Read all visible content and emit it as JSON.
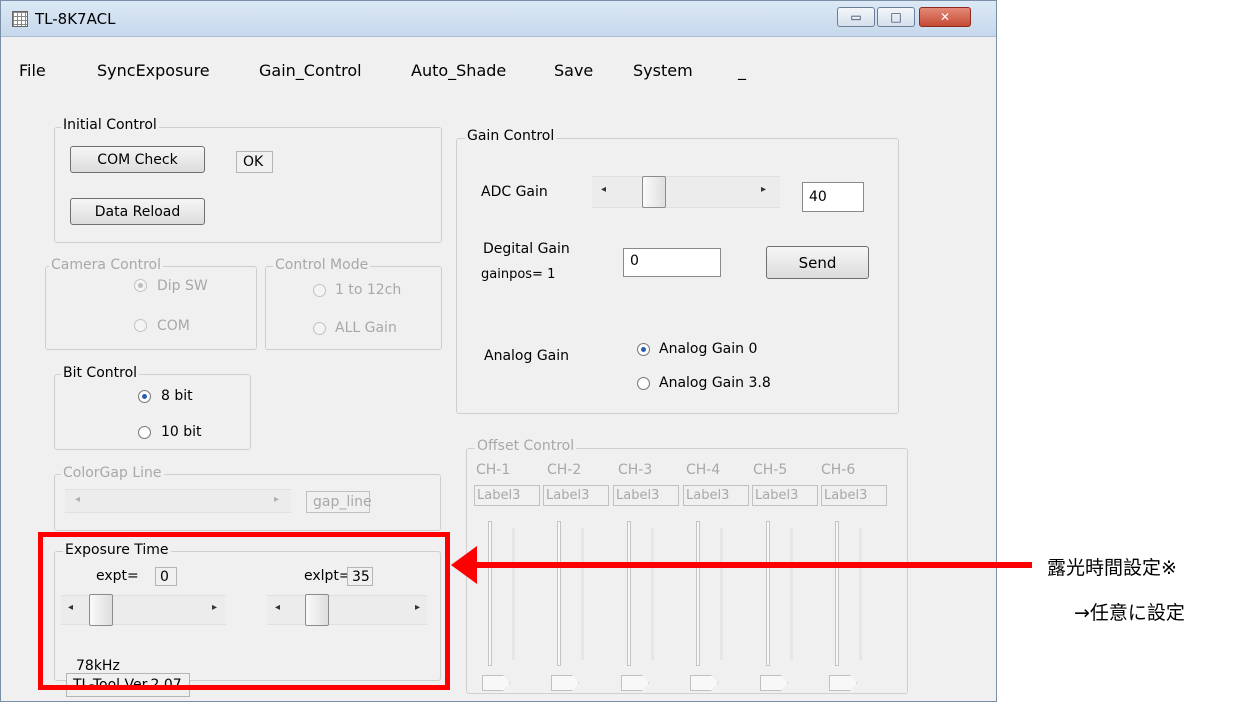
{
  "window": {
    "title": "TL-8K7ACL",
    "controls": {
      "minimize": "▭",
      "maximize": "□",
      "close": "✕"
    }
  },
  "menu": {
    "items": [
      "File",
      "SyncExposure",
      "Gain_Control",
      "Auto_Shade",
      "Save",
      "System",
      "_"
    ]
  },
  "initial_control": {
    "title": "Initial Control",
    "com_check_label": "COM Check",
    "com_status": "OK",
    "data_reload_label": "Data Reload"
  },
  "camera_control": {
    "title": "Camera Control",
    "options": [
      "Dip SW",
      "COM"
    ],
    "selected": "Dip SW"
  },
  "control_mode": {
    "title": "Control Mode",
    "options": [
      "1 to 12ch",
      "ALL Gain"
    ]
  },
  "bit_control": {
    "title": "Bit Control",
    "options": [
      "8 bit",
      "10 bit"
    ],
    "selected": "8 bit"
  },
  "color_gap": {
    "title": "ColorGap Line",
    "value": "gap_line"
  },
  "exposure_time": {
    "title": "Exposure Time",
    "expt_label": "expt=",
    "expt_value": "0",
    "exlpt_label": "exlpt=",
    "exlpt_value": "35",
    "frequency": "78kHz"
  },
  "gain_control": {
    "title": "Gain Control",
    "adc_label": "ADC Gain",
    "adc_value": "40",
    "digital_label": "Degital Gain",
    "gainpos_text": "gainpos= 1",
    "digital_value": "0",
    "send_label": "Send",
    "analog_label": "Analog Gain",
    "analog_options": [
      "Analog Gain 0",
      "Analog Gain 3.8"
    ],
    "analog_selected": "Analog Gain 0"
  },
  "offset_control": {
    "title": "Offset Control",
    "channels": [
      "CH-1",
      "CH-2",
      "CH-3",
      "CH-4",
      "CH-5",
      "CH-6"
    ],
    "value_label": "Label3"
  },
  "version": "TL-Tool Ver.2.07",
  "annotation": {
    "line1": "露光時間設定※",
    "line2": "→任意に設定",
    "color": "#ff0000"
  }
}
